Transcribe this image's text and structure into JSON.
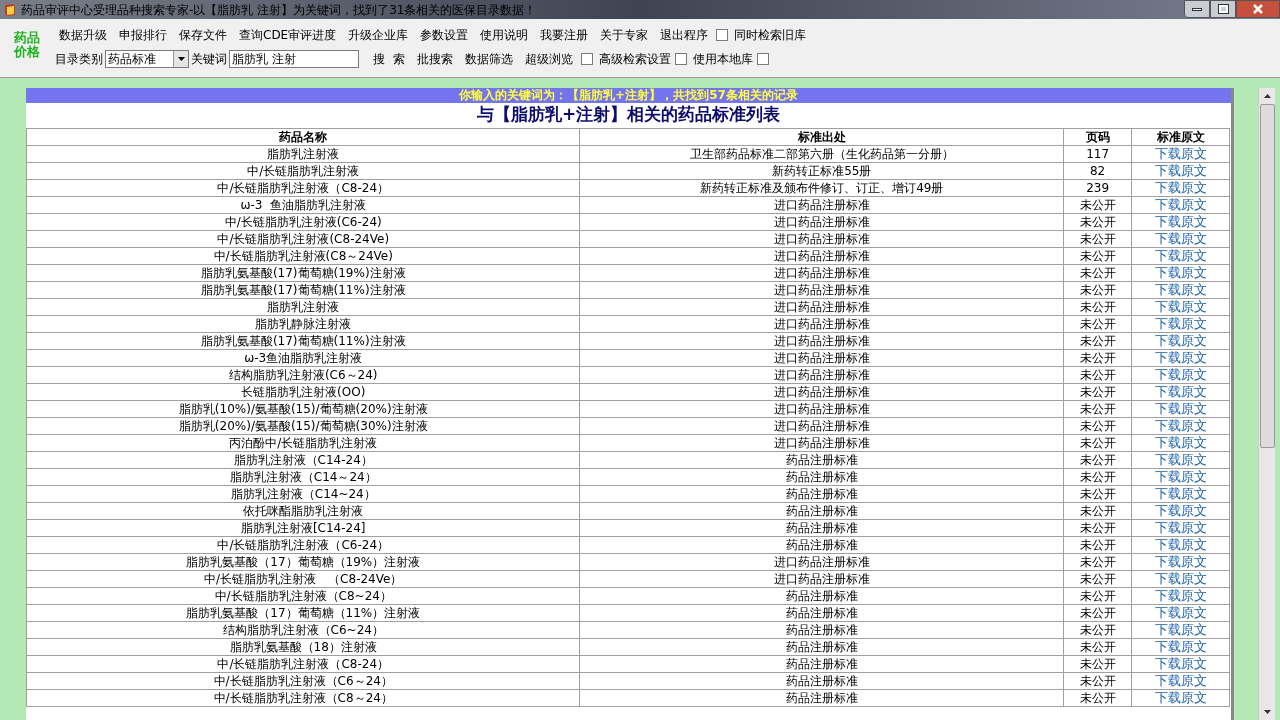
{
  "window": {
    "title": "药品审评中心受理品种搜索专家-以【脂肪乳 注射】为关键词，找到了31条相关的医保目录数据！"
  },
  "logo": {
    "lines": [
      "药品",
      "价格"
    ]
  },
  "toolbar_rows": [
    [
      {
        "kind": "button",
        "label": "数据升级"
      },
      {
        "kind": "button",
        "label": "申报排行"
      },
      {
        "kind": "button",
        "label": "保存文件"
      },
      {
        "kind": "button",
        "label": "查询CDE审评进度"
      },
      {
        "kind": "button",
        "label": "升级企业库"
      },
      {
        "kind": "button",
        "label": "参数设置"
      },
      {
        "kind": "button",
        "label": "使用说明"
      },
      {
        "kind": "button",
        "label": "我要注册"
      },
      {
        "kind": "button",
        "label": "关于专家"
      },
      {
        "kind": "button",
        "label": "退出程序"
      },
      {
        "kind": "checkbox",
        "label": "同时检索旧库",
        "checked": false
      }
    ],
    [
      {
        "kind": "label",
        "label": "目录类别"
      },
      {
        "kind": "select",
        "value": "药品标准"
      },
      {
        "kind": "label",
        "label": "关键词"
      },
      {
        "kind": "field",
        "value": "脂肪乳 注射"
      },
      {
        "kind": "button",
        "label": "搜  索"
      },
      {
        "kind": "button",
        "label": "批搜索"
      },
      {
        "kind": "button",
        "label": "数据筛选"
      },
      {
        "kind": "button",
        "label": "超级浏览"
      },
      {
        "kind": "checkbox",
        "label": "高级检索设置",
        "checked": false
      },
      {
        "kind": "checkbox",
        "label": "使用本地库",
        "checked": false
      },
      {
        "kind": "checkbox",
        "checked": false
      }
    ]
  ],
  "results": {
    "banner": "你输入的关键词为：【脂肪乳+注射】，共找到57条相关的记录",
    "heading": "与【脂肪乳+注射】相关的药品标准列表",
    "columns": [
      "药品名称",
      "标准出处",
      "页码",
      "标准原文"
    ],
    "rows": [
      [
        "脂肪乳注射液",
        "卫生部药品标准二部第六册（生化药品第一分册）",
        "117",
        "下载原文"
      ],
      [
        "中/长链脂肪乳注射液",
        "新药转正标准55册",
        "82",
        "下载原文"
      ],
      [
        "中/长链脂肪乳注射液（C8-24）",
        "新药转正标准及颁布件修订、订正、增订49册",
        "239",
        "下载原文"
      ],
      [
        "ω-3  鱼油脂肪乳注射液",
        "进口药品注册标准",
        "未公开",
        "下载原文"
      ],
      [
        "中/长链脂肪乳注射液(C6-24)",
        "进口药品注册标准",
        "未公开",
        "下载原文"
      ],
      [
        "中/长链脂肪乳注射液(C8-24Ve)",
        "进口药品注册标准",
        "未公开",
        "下载原文"
      ],
      [
        "中/长链脂肪乳注射液(C8～24Ve)",
        "进口药品注册标准",
        "未公开",
        "下载原文"
      ],
      [
        "脂肪乳氨基酸(17)葡萄糖(19%)注射液",
        "进口药品注册标准",
        "未公开",
        "下载原文"
      ],
      [
        "脂肪乳氨基酸(17)葡萄糖(11%)注射液",
        "进口药品注册标准",
        "未公开",
        "下载原文"
      ],
      [
        "脂肪乳注射液",
        "进口药品注册标准",
        "未公开",
        "下载原文"
      ],
      [
        "脂肪乳静脉注射液",
        "进口药品注册标准",
        "未公开",
        "下载原文"
      ],
      [
        "脂肪乳氨基酸(17)葡萄糖(11%)注射液",
        "进口药品注册标准",
        "未公开",
        "下载原文"
      ],
      [
        "ω-3鱼油脂肪乳注射液",
        "进口药品注册标准",
        "未公开",
        "下载原文"
      ],
      [
        "结构脂肪乳注射液(C6～24)",
        "进口药品注册标准",
        "未公开",
        "下载原文"
      ],
      [
        "长链脂肪乳注射液(OO)",
        "进口药品注册标准",
        "未公开",
        "下载原文"
      ],
      [
        "脂肪乳(10%)/氨基酸(15)/葡萄糖(20%)注射液",
        "进口药品注册标准",
        "未公开",
        "下载原文"
      ],
      [
        "脂肪乳(20%)/氨基酸(15)/葡萄糖(30%)注射液",
        "进口药品注册标准",
        "未公开",
        "下载原文"
      ],
      [
        "丙泊酚中/长链脂肪乳注射液",
        "进口药品注册标准",
        "未公开",
        "下载原文"
      ],
      [
        "脂肪乳注射液（C14-24）",
        "药品注册标准",
        "未公开",
        "下载原文"
      ],
      [
        "脂肪乳注射液（C14～24）",
        "药品注册标准",
        "未公开",
        "下载原文"
      ],
      [
        "脂肪乳注射液（C14~24）",
        "药品注册标准",
        "未公开",
        "下载原文"
      ],
      [
        "依托咪酯脂肪乳注射液",
        "药品注册标准",
        "未公开",
        "下载原文"
      ],
      [
        "脂肪乳注射液[C14-24]",
        "药品注册标准",
        "未公开",
        "下载原文"
      ],
      [
        "中/长链脂肪乳注射液（C6-24）",
        "药品注册标准",
        "未公开",
        "下载原文"
      ],
      [
        "脂肪乳氨基酸（17）葡萄糖（19%）注射液",
        "进口药品注册标准",
        "未公开",
        "下载原文"
      ],
      [
        "中/长链脂肪乳注射液　（C8-24Ve）",
        "进口药品注册标准",
        "未公开",
        "下载原文"
      ],
      [
        "中/长链脂肪乳注射液（C8~24）",
        "药品注册标准",
        "未公开",
        "下载原文"
      ],
      [
        "脂肪乳氨基酸（17）葡萄糖（11%）注射液",
        "药品注册标准",
        "未公开",
        "下载原文"
      ],
      [
        "结构脂肪乳注射液（C6~24）",
        "药品注册标准",
        "未公开",
        "下载原文"
      ],
      [
        "脂肪乳氨基酸（18）注射液",
        "药品注册标准",
        "未公开",
        "下载原文"
      ],
      [
        "中/长链脂肪乳注射液（C8-24）",
        "药品注册标准",
        "未公开",
        "下载原文"
      ],
      [
        "中/长链脂肪乳注射液（C6～24）",
        "药品注册标准",
        "未公开",
        "下载原文"
      ],
      [
        "中/长链脂肪乳注射液（C8～24）",
        "药品注册标准",
        "未公开",
        "下载原文"
      ]
    ]
  }
}
